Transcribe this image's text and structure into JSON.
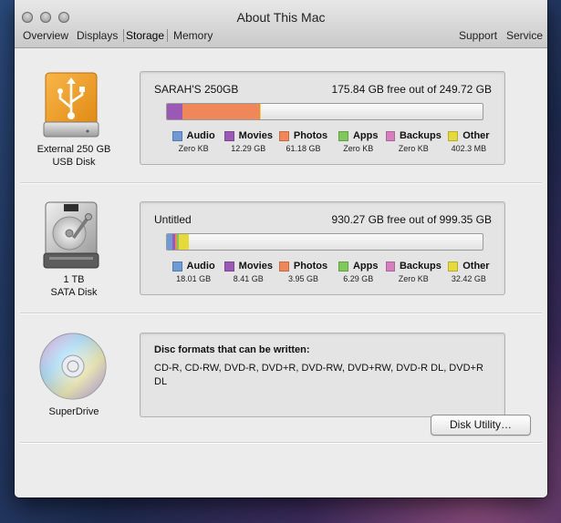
{
  "window": {
    "title": "About This Mac"
  },
  "tabs": [
    {
      "label": "Overview"
    },
    {
      "label": "Displays"
    },
    {
      "label": "Storage"
    },
    {
      "label": "Memory"
    },
    {
      "label": "Support"
    },
    {
      "label": "Service"
    }
  ],
  "selected_tab": "Storage",
  "drives": [
    {
      "label_line1": "External 250 GB",
      "label_line2": "USB Disk",
      "icon": "usb-drive-icon",
      "disk_name": "SARAH'S 250GB",
      "free_text": "175.84 GB free out of 249.72 GB",
      "usage_fractions": {
        "Audio": 0,
        "Movies": 0.05,
        "Photos": 0.245,
        "Apps": 0,
        "Backups": 0,
        "Other": 0.0016
      },
      "legend": [
        {
          "name": "Audio",
          "value": "Zero KB",
          "color": "#6f9ad6"
        },
        {
          "name": "Movies",
          "value": "12.29 GB",
          "color": "#9b59b6"
        },
        {
          "name": "Photos",
          "value": "61.18 GB",
          "color": "#f0875b"
        },
        {
          "name": "Apps",
          "value": "Zero KB",
          "color": "#7fc95b"
        },
        {
          "name": "Backups",
          "value": "Zero KB",
          "color": "#d67fbe"
        },
        {
          "name": "Other",
          "value": "402.3 MB",
          "color": "#e6d93c"
        }
      ]
    },
    {
      "label_line1": "1 TB",
      "label_line2": "SATA Disk",
      "icon": "hard-disk-icon",
      "disk_name": "Untitled",
      "free_text": "930.27 GB free out of 999.35 GB",
      "usage_fractions": {
        "Audio": 0.018,
        "Movies": 0.0084,
        "Photos": 0.004,
        "Apps": 0.0063,
        "Backups": 0,
        "Other": 0.0324
      },
      "legend": [
        {
          "name": "Audio",
          "value": "18.01 GB",
          "color": "#6f9ad6"
        },
        {
          "name": "Movies",
          "value": "8.41 GB",
          "color": "#9b59b6"
        },
        {
          "name": "Photos",
          "value": "3.95 GB",
          "color": "#f0875b"
        },
        {
          "name": "Apps",
          "value": "6.29 GB",
          "color": "#7fc95b"
        },
        {
          "name": "Backups",
          "value": "Zero KB",
          "color": "#d67fbe"
        },
        {
          "name": "Other",
          "value": "32.42 GB",
          "color": "#e6d93c"
        }
      ]
    }
  ],
  "superdrive": {
    "label": "SuperDrive",
    "icon": "optical-disc-icon",
    "disc_title": "Disc formats that can be written:",
    "disc_formats": "CD-R, CD-RW, DVD-R, DVD+R, DVD-RW, DVD+RW, DVD-R DL, DVD+R DL"
  },
  "buttons": {
    "disk_utility": "Disk Utility…"
  }
}
